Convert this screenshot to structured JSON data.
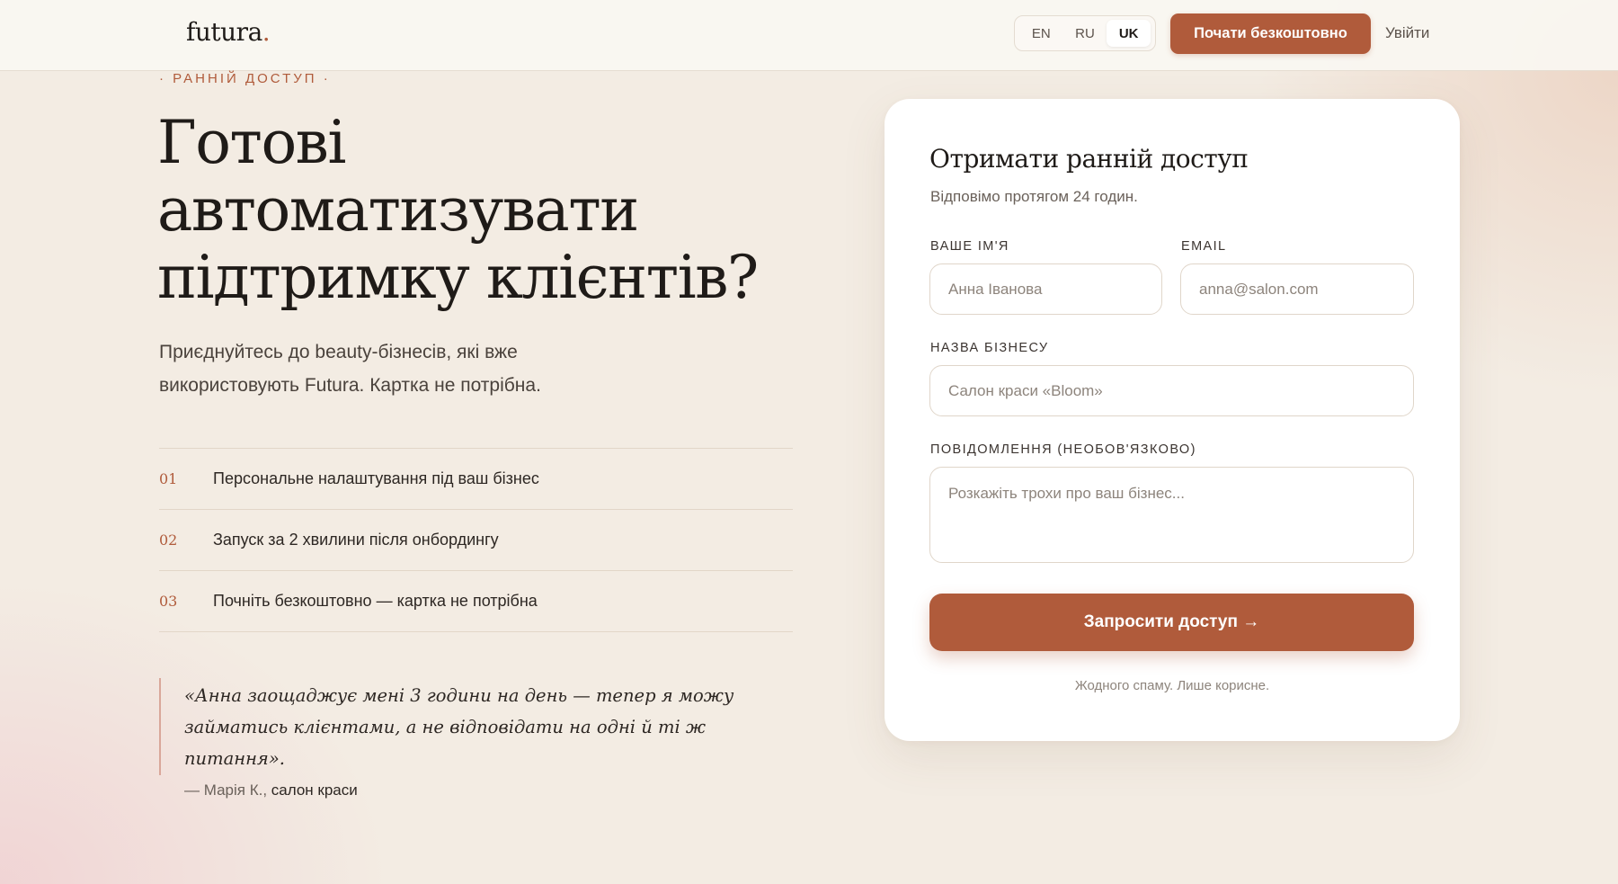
{
  "header": {
    "logo": "futura",
    "logo_dot": ".",
    "languages": [
      "EN",
      "RU",
      "UK"
    ],
    "active_language": "UK",
    "cta_label": "Почати безкоштовно",
    "logout_label": "Увійти"
  },
  "hero": {
    "eyebrow": "· РАННІЙ ДОСТУП ·",
    "title": "Готові автоматизувати підтримку клієнтів?",
    "subtitle": "Приєднуйтесь до beauty-бізнесів, які вже використовують Futura. Картка не потрібна."
  },
  "benefits": [
    {
      "num": "01",
      "text": "Персональне налаштування під ваш бізнес"
    },
    {
      "num": "02",
      "text": "Запуск за 2 хвилини після онбордингу"
    },
    {
      "num": "03",
      "text": "Почніть безкоштовно — картка не потрібна"
    }
  ],
  "testimonial": {
    "quote": "«Анна заощаджує мені 3 години на день — тепер я можу займатись клієнтами, а не відповідати на одні й ті ж питання».",
    "author": "— Марія К., ",
    "role": "салон краси"
  },
  "form": {
    "title": "Отримати ранній доступ",
    "subtitle": "Відповімо протягом 24 годин.",
    "name_label": "ВАШЕ ІМ'Я",
    "name_placeholder": "Анна Іванова",
    "email_label": "EMAIL",
    "email_placeholder": "anna@salon.com",
    "business_label": "НАЗВА БІЗНЕСУ",
    "business_placeholder": "Салон краси «Bloom»",
    "message_label": "ПОВІДОМЛЕННЯ (НЕОБОВ'ЯЗКОВО)",
    "message_placeholder": "Розкажіть трохи про ваш бізнес...",
    "submit_label": "Запросити доступ →",
    "note": "Жодного спаму. Лише корисне."
  },
  "colors": {
    "accent": "#b05b3b",
    "background": "#f3ece3",
    "card": "#ffffff",
    "text": "#1f1b18"
  }
}
